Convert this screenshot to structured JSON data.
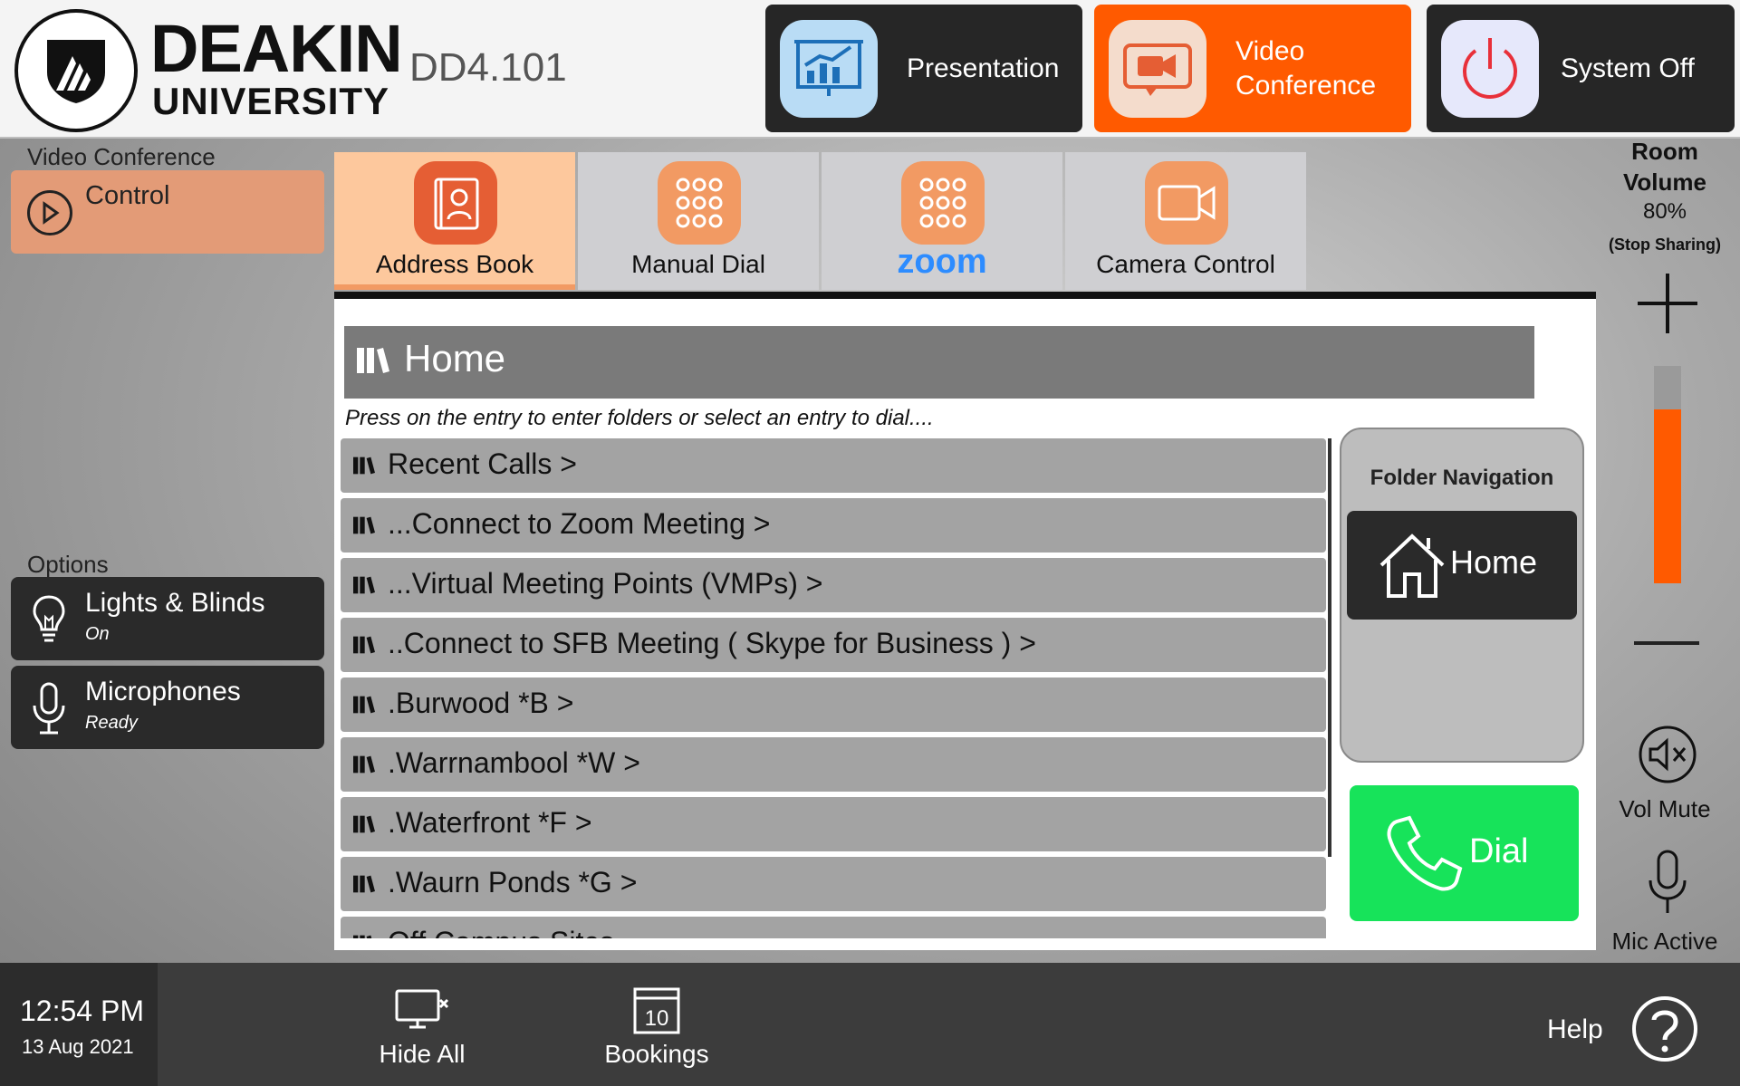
{
  "header": {
    "logo_line1": "DEAKIN",
    "logo_line2": "UNIVERSITY",
    "room_code": "DD4.101",
    "modes": [
      {
        "label": "Presentation",
        "icon": "presentation-chart-icon"
      },
      {
        "label": "Video Conference",
        "icon": "video-camera-icon"
      },
      {
        "label": "System Off",
        "icon": "power-icon"
      }
    ]
  },
  "sidebar": {
    "section_label": "Video Conference",
    "control_label": "Control",
    "options_label": "Options",
    "lights": {
      "title": "Lights & Blinds",
      "status": "On"
    },
    "mics": {
      "title": "Microphones",
      "status": "Ready"
    }
  },
  "tabs": [
    {
      "label": "Address Book",
      "icon": "address-book-icon"
    },
    {
      "label": "Manual Dial",
      "icon": "keypad-icon"
    },
    {
      "label": "zoom",
      "icon": "keypad-icon"
    },
    {
      "label": "Camera Control",
      "icon": "camera-icon"
    }
  ],
  "address_book": {
    "current_folder": "Home",
    "hint": "Press on the entry to enter folders or select an entry to dial....",
    "entries": [
      "Recent Calls >",
      "...Connect to Zoom Meeting >",
      "...Virtual Meeting Points (VMPs) >",
      "..Connect to SFB Meeting ( Skype for Business ) >",
      ".Burwood *B >",
      ".Warrnambool *W >",
      ".Waterfront *F >",
      ".Waurn Ponds *G >",
      "Off Campus Sites"
    ],
    "folder_nav_title": "Folder Navigation",
    "home_button": "Home",
    "dial_button": "Dial"
  },
  "volume": {
    "title": "Room Volume",
    "level_text": "80%",
    "level": 0.8,
    "note": "(Stop Sharing)",
    "mute_label": "Vol Mute",
    "mic_label": "Mic Active"
  },
  "footer": {
    "time": "12:54 PM",
    "date": "13 Aug 2021",
    "hide_all": "Hide All",
    "bookings": "Bookings",
    "bookings_day": "10",
    "help": "Help"
  },
  "colors": {
    "accent_orange": "#ff5a00",
    "tab_icon_orange": "#f29a63",
    "dial_green": "#17e35a",
    "zoom_blue": "#2d8cff"
  }
}
